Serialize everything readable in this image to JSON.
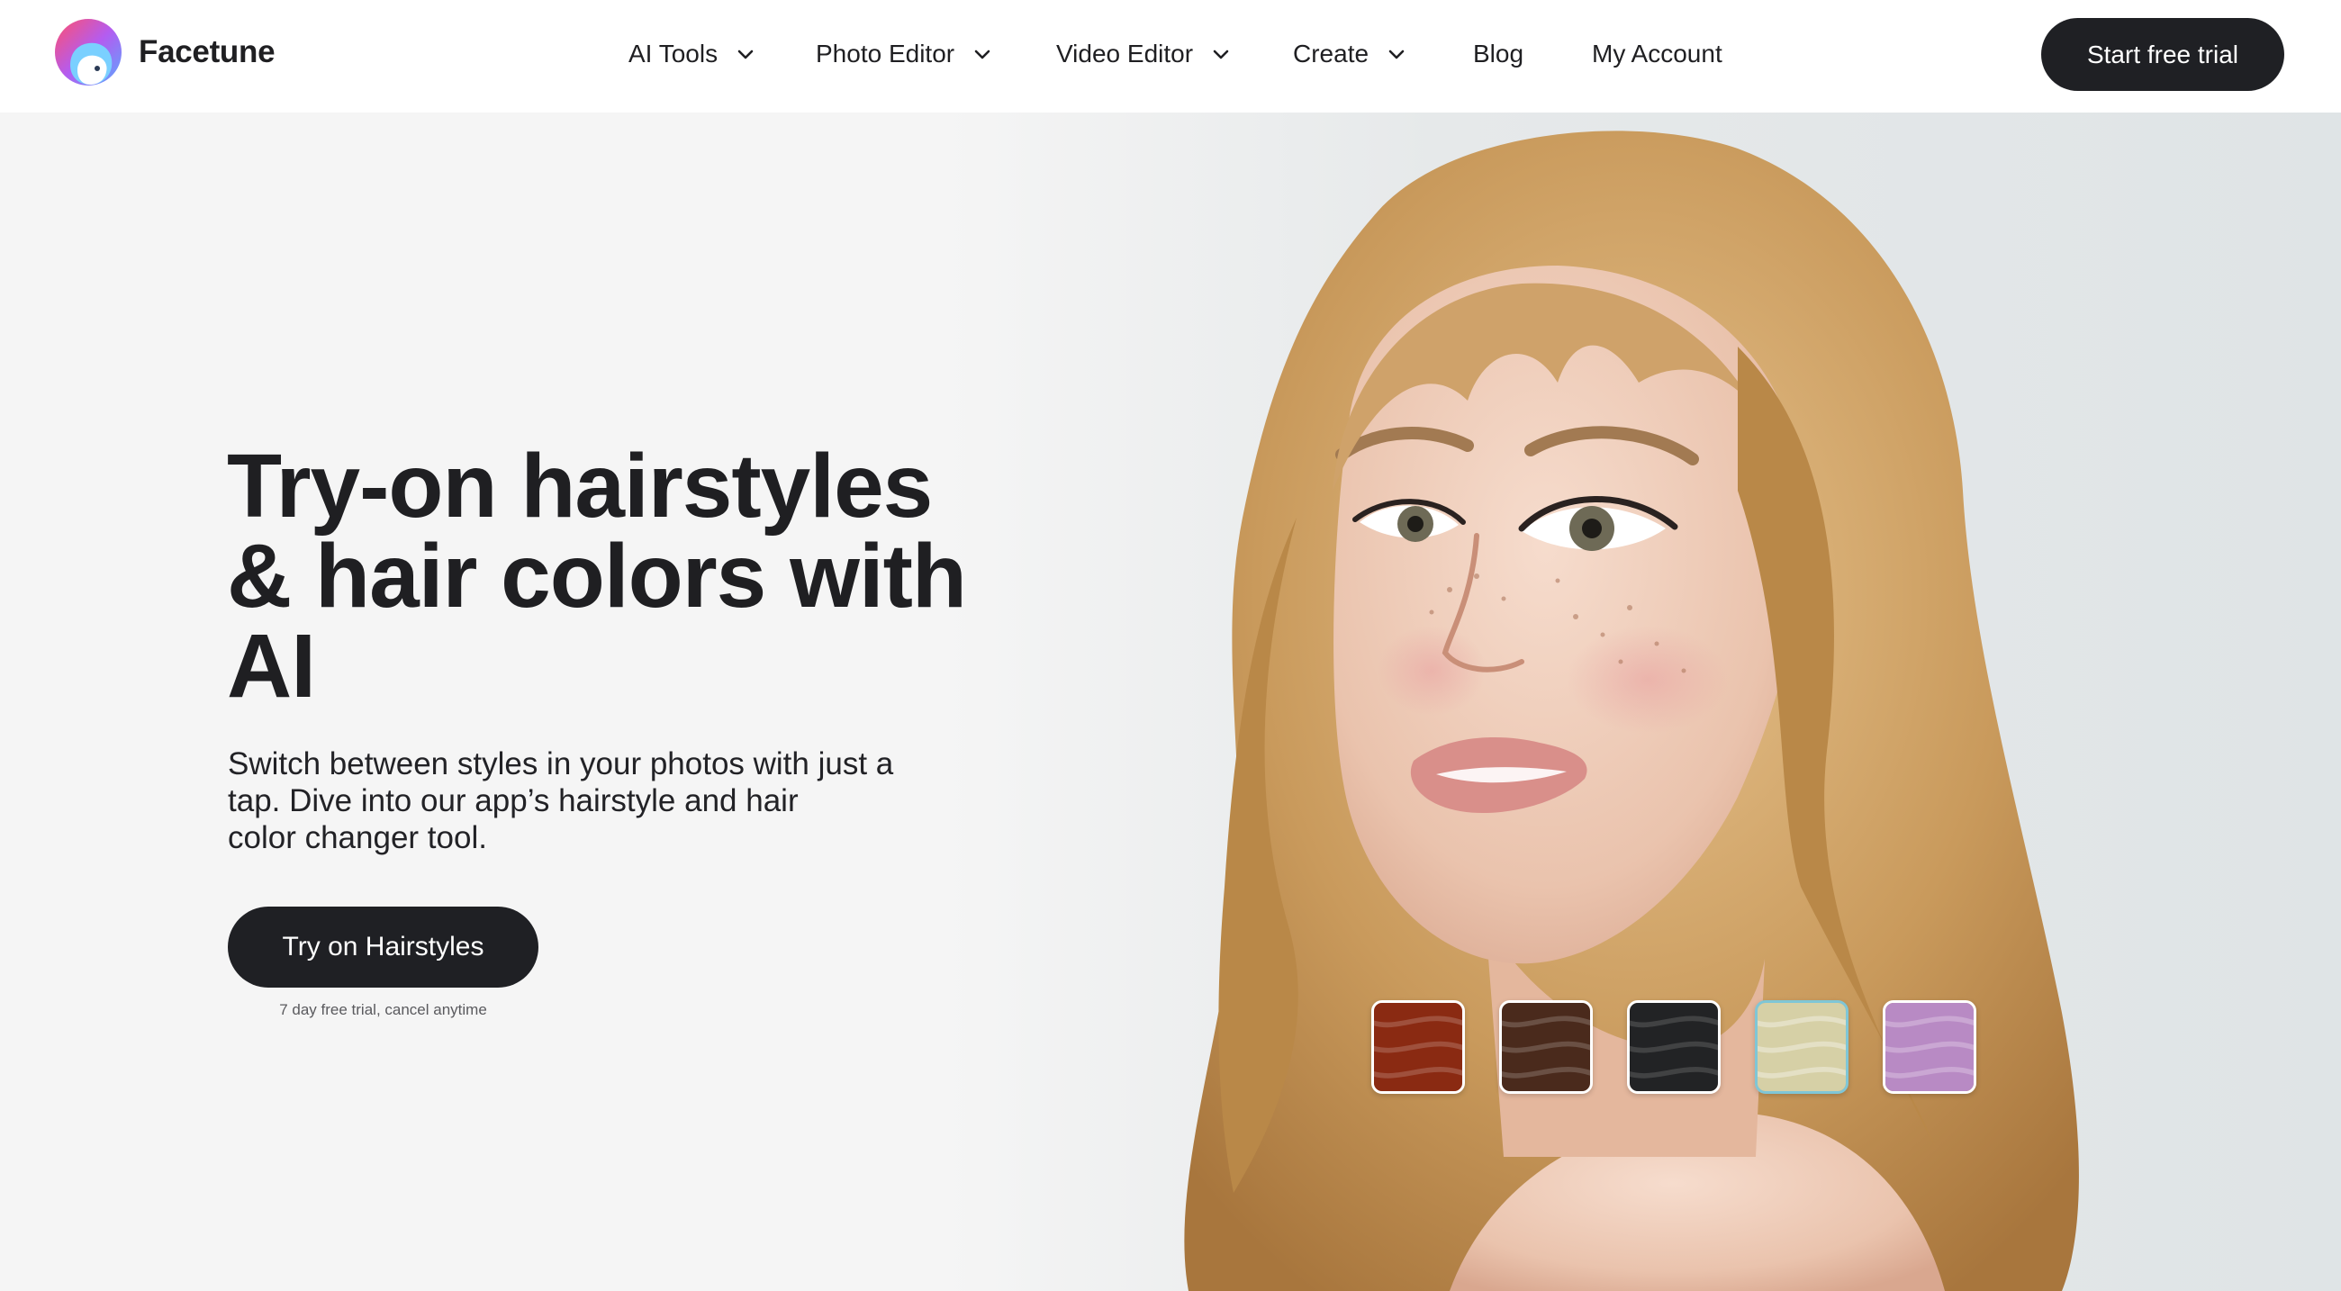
{
  "brand": {
    "name": "Facetune",
    "icon": "facetune-logo-icon"
  },
  "nav": {
    "items": [
      {
        "label": "AI Tools",
        "has_dropdown": true
      },
      {
        "label": "Photo Editor",
        "has_dropdown": true
      },
      {
        "label": "Video Editor",
        "has_dropdown": true
      },
      {
        "label": "Create",
        "has_dropdown": true
      },
      {
        "label": "Blog",
        "has_dropdown": false
      },
      {
        "label": "My Account",
        "has_dropdown": false
      }
    ],
    "cta_label": "Start free trial"
  },
  "hero": {
    "headline_lines": [
      "Try-on hairstyles",
      "& hair colors with",
      "AI"
    ],
    "subtitle_lines": [
      "Switch between styles in your photos with just a",
      "tap. Dive into our app’s hairstyle and hair",
      "color changer tool."
    ],
    "cta_label": "Try on Hairstyles",
    "cta_note": "7 day free trial, cancel anytime"
  },
  "hair_swatches": [
    {
      "name": "red",
      "color": "#8a2a12",
      "selected": false
    },
    {
      "name": "brown",
      "color": "#4a2a1c",
      "selected": false
    },
    {
      "name": "black",
      "color": "#222325",
      "selected": false
    },
    {
      "name": "platinum-blonde",
      "color": "#d6d0a6",
      "selected": true
    },
    {
      "name": "lavender",
      "color": "#b88ac4",
      "selected": false
    }
  ],
  "colors": {
    "primary_button": "#1f2024",
    "background": "#f5f5f5",
    "selected_swatch_border": "#7fc6d6"
  }
}
